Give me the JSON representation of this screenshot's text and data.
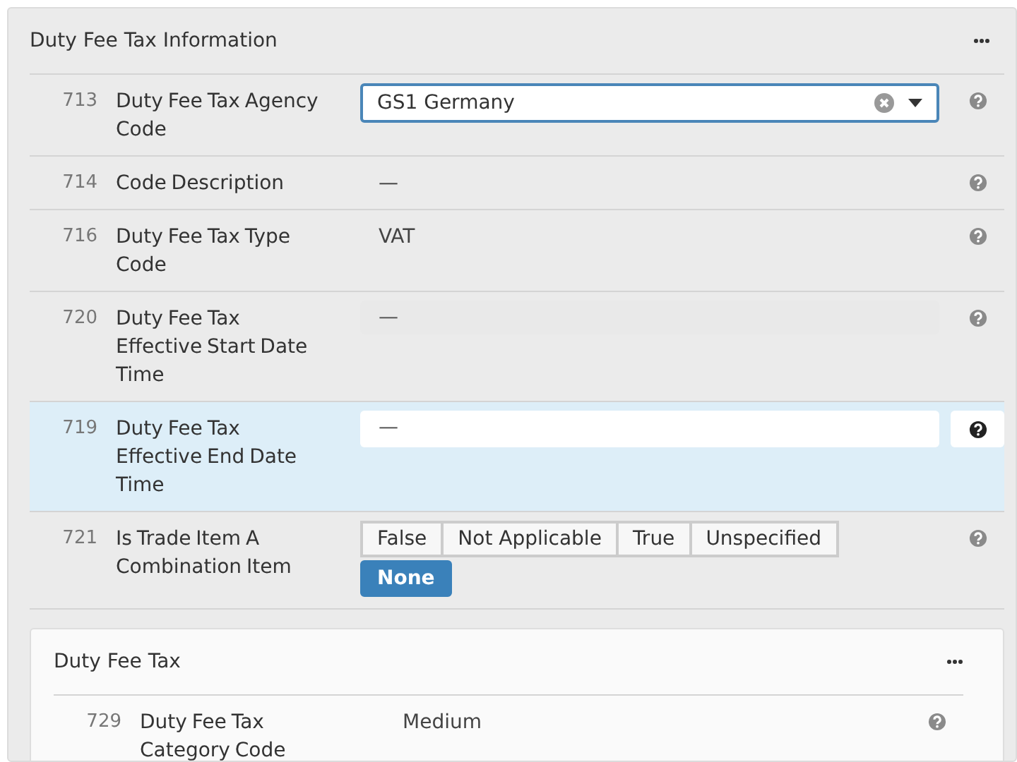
{
  "panel": {
    "title": "Duty Fee Tax Information",
    "rows": [
      {
        "kind": "select",
        "number": "713",
        "label": "Duty Fee Tax Agency Code",
        "value": "GS1 Germany",
        "focused": false
      },
      {
        "kind": "text",
        "number": "714",
        "label": "Code Description",
        "value": "—",
        "focused": false
      },
      {
        "kind": "text",
        "number": "716",
        "label": "Duty Fee Tax Type Code",
        "value": "VAT",
        "focused": false
      },
      {
        "kind": "date",
        "number": "720",
        "label": "Duty Fee Tax Effective Start Date Time",
        "value": "—",
        "focused": false
      },
      {
        "kind": "date",
        "number": "719",
        "label": "Duty Fee Tax Effective End Date Time",
        "value": "—",
        "focused": true
      },
      {
        "kind": "radio",
        "number": "721",
        "label": "Is Trade Item A Combination Item",
        "focused": false,
        "options": [
          {
            "label": "False",
            "selected": false
          },
          {
            "label": "Not Applicable",
            "selected": false
          },
          {
            "label": "True",
            "selected": false
          },
          {
            "label": "Unspecified",
            "selected": false
          },
          {
            "label": "None",
            "selected": true
          }
        ]
      }
    ],
    "subpanel": {
      "title": "Duty Fee Tax",
      "rows": [
        {
          "kind": "text",
          "number": "729",
          "label": "Duty Fee Tax Category Code",
          "value": "Medium",
          "focused": false
        }
      ]
    }
  }
}
